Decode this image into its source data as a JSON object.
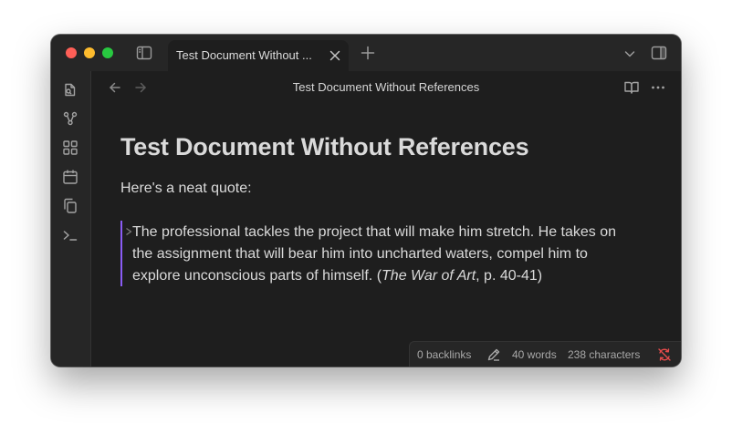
{
  "tab": {
    "title": "Test Document Without ..."
  },
  "view": {
    "title": "Test Document Without References"
  },
  "document": {
    "heading": "Test Document Without References",
    "intro": "Here's a neat quote:",
    "quote_text": "The professional tackles the project that will make him stretch. He takes on the assignment that will bear him into uncharted waters, compel him to explore unconscious parts of himself. (",
    "quote_source": "The War of Art",
    "quote_pages": ", p. 40-41)"
  },
  "status": {
    "backlinks": "0 backlinks",
    "words": "40 words",
    "characters": "238 characters"
  },
  "icons": {
    "sidebar_toggle": "sidebar-left-icon",
    "tab_close": "close-icon",
    "new_tab": "plus-icon",
    "tab_list": "chevron-down-icon",
    "right_sidebar": "sidebar-right-icon",
    "ribbon": [
      "open-file-icon",
      "graph-icon",
      "canvas-icon",
      "calendar-icon",
      "copy-icon",
      "terminal-icon"
    ],
    "nav": [
      "arrow-left-icon",
      "arrow-right-icon"
    ],
    "view": [
      "book-open-icon",
      "more-horizontal-icon"
    ],
    "status": [
      "edit-pencil-icon",
      "sync-off-icon"
    ]
  },
  "colors": {
    "background": "#1e1e1e",
    "chrome": "#262626",
    "text": "#dadada",
    "muted": "#a8a8a8",
    "accent": "#8a5cf5",
    "sync_error": "#e34b4b"
  }
}
